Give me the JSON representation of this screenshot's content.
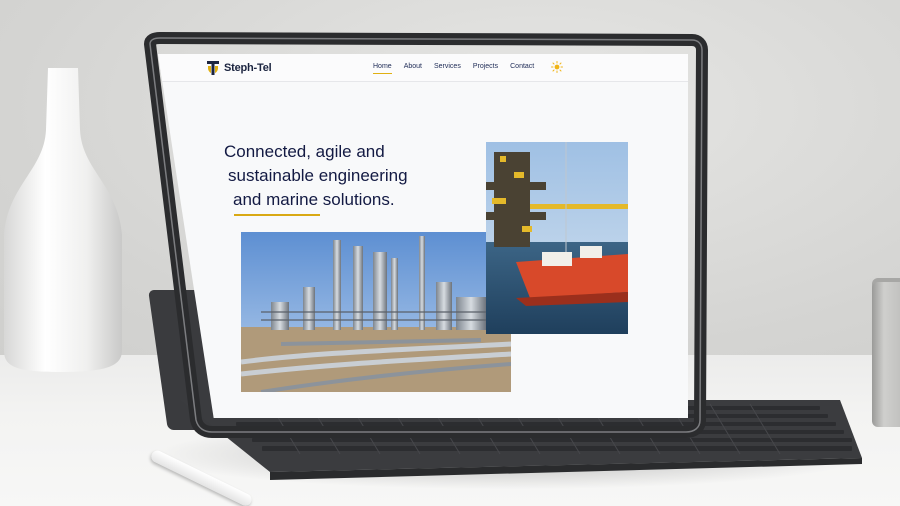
{
  "site": {
    "brand": "Steph-Tel",
    "brand_primary": "Steph",
    "brand_secondary": "-Tel",
    "brand_color": "#1c2540",
    "accent_color": "#e0b012"
  },
  "nav": {
    "items": [
      {
        "label": "Home",
        "active": true
      },
      {
        "label": "About",
        "active": false
      },
      {
        "label": "Services",
        "active": false
      },
      {
        "label": "Projects",
        "active": false
      },
      {
        "label": "Contact",
        "active": false
      }
    ],
    "theme_toggle_icon": "sun-icon"
  },
  "hero": {
    "headline_lines": [
      "Connected, agile and",
      "sustainable engineering",
      "and marine solutions."
    ],
    "images": [
      "refinery-photo",
      "offshore-rig-photo"
    ]
  }
}
